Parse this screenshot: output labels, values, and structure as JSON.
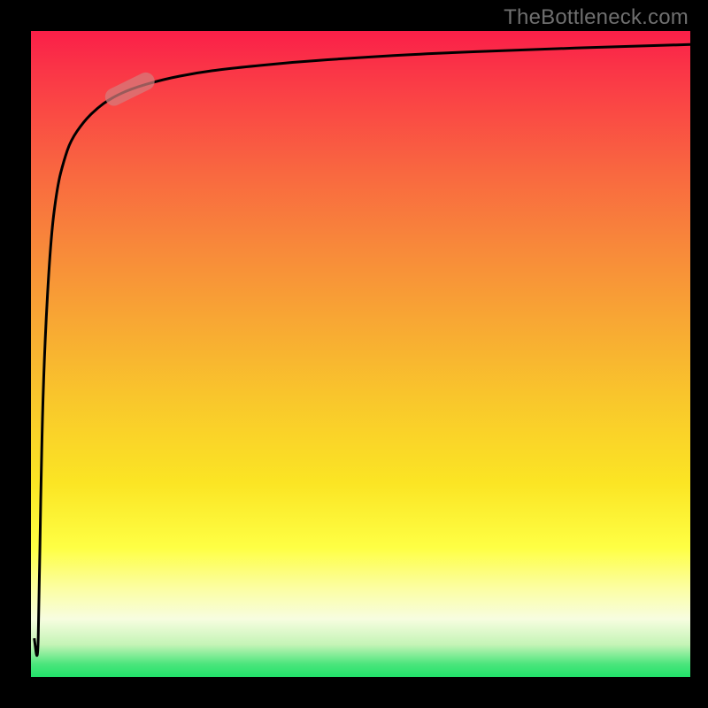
{
  "watermark": "TheBottleneck.com",
  "chart_data": {
    "type": "line",
    "title": "",
    "xlabel": "",
    "ylabel": "",
    "xlim": [
      0,
      100
    ],
    "ylim": [
      0,
      100
    ],
    "series": [
      {
        "name": "bottleneck-curve",
        "x": [
          0.5,
          1.0,
          1.2,
          1.5,
          2,
          3,
          4,
          5,
          6,
          8,
          10,
          12,
          15,
          20,
          25,
          30,
          40,
          50,
          60,
          75,
          90,
          100
        ],
        "values": [
          6,
          2,
          10,
          30,
          50,
          68,
          76,
          80,
          83,
          86,
          88,
          89.5,
          91,
          92.5,
          93.5,
          94.2,
          95.2,
          95.9,
          96.5,
          97.1,
          97.6,
          97.9
        ]
      },
      {
        "name": "highlight-marker",
        "x": [
          15
        ],
        "values": [
          91
        ]
      }
    ],
    "gradient_colors": {
      "top": "#fb1f48",
      "mid_orange": "#f88a3a",
      "mid_yellow": "#fbe524",
      "pale": "#f7fde0",
      "bottom": "#21e26a"
    }
  }
}
